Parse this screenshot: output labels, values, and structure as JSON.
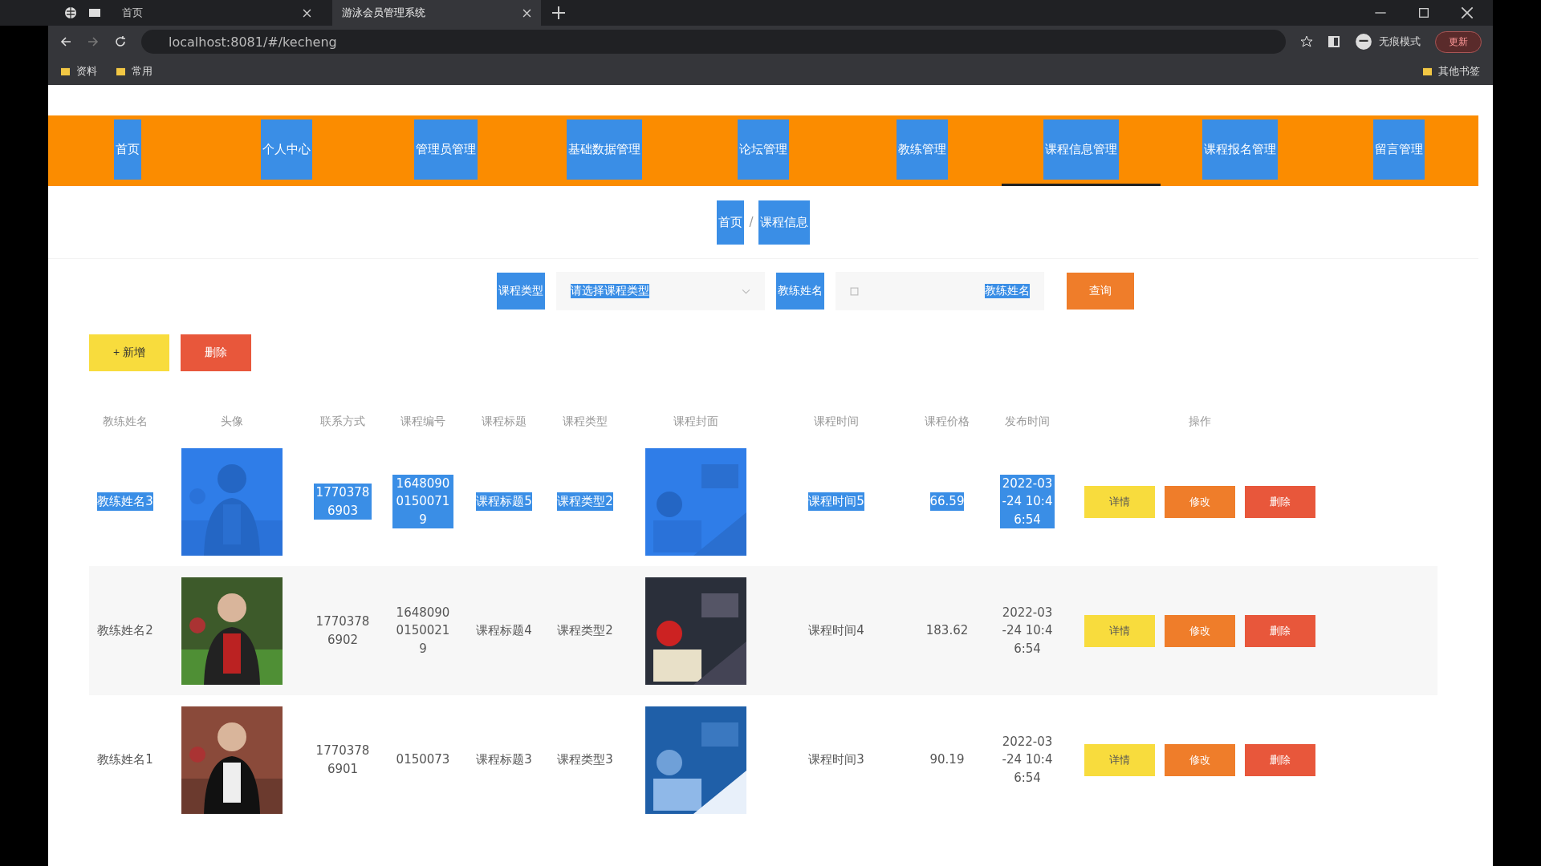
{
  "browser": {
    "tabs": [
      {
        "title": "首页",
        "selected": false
      },
      {
        "title": "游泳会员管理系统",
        "selected": true
      }
    ],
    "address": "localhost:8081/#/kecheng",
    "profile": "无痕模式",
    "update_button": "更新",
    "bookmarks": [
      "资料",
      "常用"
    ],
    "other_bookmarks": "其他书签"
  },
  "text_selected": true,
  "nav": [
    {
      "label": "首页",
      "selected": false
    },
    {
      "label": "个人中心",
      "selected": false
    },
    {
      "label": "管理员管理",
      "selected": false
    },
    {
      "label": "基础数据管理",
      "selected": false
    },
    {
      "label": "论坛管理",
      "selected": false
    },
    {
      "label": "教练管理",
      "selected": false
    },
    {
      "label": "课程信息管理",
      "selected": true
    },
    {
      "label": "课程报名管理",
      "selected": false
    },
    {
      "label": "留言管理",
      "selected": false
    }
  ],
  "breadcrumb": [
    "首页",
    "/",
    "课程信息"
  ],
  "search": {
    "type_label": "课程类型",
    "type_placeholder": "请选择课程类型",
    "name_label": "教练姓名",
    "name_placeholder": "教练姓名",
    "button": "查询"
  },
  "actions": {
    "add": "+ 新增",
    "delete": "删除"
  },
  "table": {
    "columns": [
      "教练姓名",
      "头像",
      "联系方式",
      "课程编号",
      "课程标题",
      "课程类型",
      "课程封面",
      "课程时间",
      "课程价格",
      "发布时间",
      "操作"
    ],
    "rows": [
      {
        "selected": true,
        "coach": "教练姓名3",
        "phone": "17703786903",
        "code": "164809001500719",
        "title": "课程标题5",
        "type": "课程类型2",
        "time": "课程时间5",
        "price": "66.59",
        "published": "2022-03-24 10:46:54"
      },
      {
        "selected": false,
        "coach": "教练姓名2",
        "phone": "17703786902",
        "code": "164809001500219",
        "title": "课程标题4",
        "type": "课程类型2",
        "time": "课程时间4",
        "price": "183.62",
        "published": "2022-03-24 10:46:54"
      },
      {
        "selected": false,
        "coach": "教练姓名1",
        "phone": "17703786901",
        "code": "0150073",
        "title": "课程标题3",
        "type": "课程类型3",
        "time": "课程时间3",
        "price": "90.19",
        "published": "2022-03-24 10:46:54"
      }
    ],
    "row_buttons": [
      {
        "detail": "详情",
        "edit": "修改",
        "delete": "删除"
      },
      {
        "detail": "详情",
        "edit": "修改",
        "delete": "删除"
      },
      {
        "detail": "详情",
        "edit": "修改",
        "delete": "删除"
      }
    ]
  }
}
